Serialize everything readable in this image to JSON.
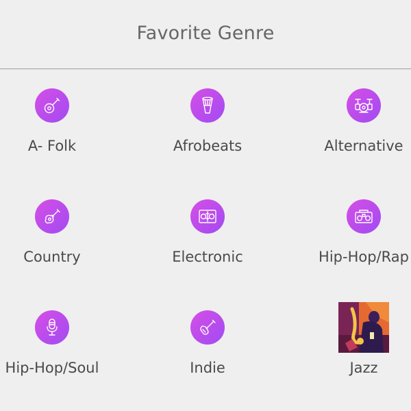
{
  "header": {
    "title": "Favorite Genre"
  },
  "accent_gradient": [
    "#d64ee6",
    "#a14bf2"
  ],
  "genres": [
    {
      "label": "A- Folk",
      "icon": "banjo-icon"
    },
    {
      "label": "Afrobeats",
      "icon": "djembe-drum-icon"
    },
    {
      "label": "Alternative",
      "icon": "drum-kit-icon"
    },
    {
      "label": "Country",
      "icon": "acoustic-guitar-icon"
    },
    {
      "label": "Electronic",
      "icon": "turntable-mixer-icon"
    },
    {
      "label": "Hip-Hop/Rap",
      "icon": "boombox-icon"
    },
    {
      "label": "Hip-Hop/Soul",
      "icon": "microphone-icon"
    },
    {
      "label": "Indie",
      "icon": "electric-guitar-icon"
    },
    {
      "label": "Jazz",
      "icon": "jazz-saxophone-artwork"
    }
  ]
}
